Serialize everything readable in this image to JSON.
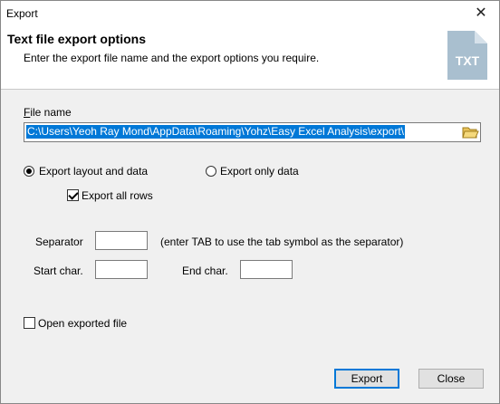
{
  "window": {
    "title": "Export"
  },
  "header": {
    "title": "Text file export options",
    "subtitle": "Enter the export file name and the export options you require.",
    "icon_label": "TXT"
  },
  "file": {
    "label": "File name",
    "path": "C:\\Users\\Yeoh Ray Mond\\AppData\\Roaming\\Yohz\\Easy Excel Analysis\\export\\"
  },
  "options": {
    "export_layout_label": "Export layout and data",
    "export_layout_selected": true,
    "export_data_only_label": "Export only data",
    "export_data_only_selected": false,
    "export_all_rows_label": "Export all rows",
    "export_all_rows_checked": true
  },
  "separator": {
    "label": "Separator",
    "value": "",
    "hint": "(enter TAB to use the tab symbol as the separator)"
  },
  "start_char": {
    "label": "Start char.",
    "value": ""
  },
  "end_char": {
    "label": "End char.",
    "value": ""
  },
  "open_file": {
    "label": "Open exported file",
    "checked": false
  },
  "buttons": {
    "export": "Export",
    "close": "Close"
  },
  "colors": {
    "selection": "#0078d7",
    "default_border": "#0078d7"
  }
}
